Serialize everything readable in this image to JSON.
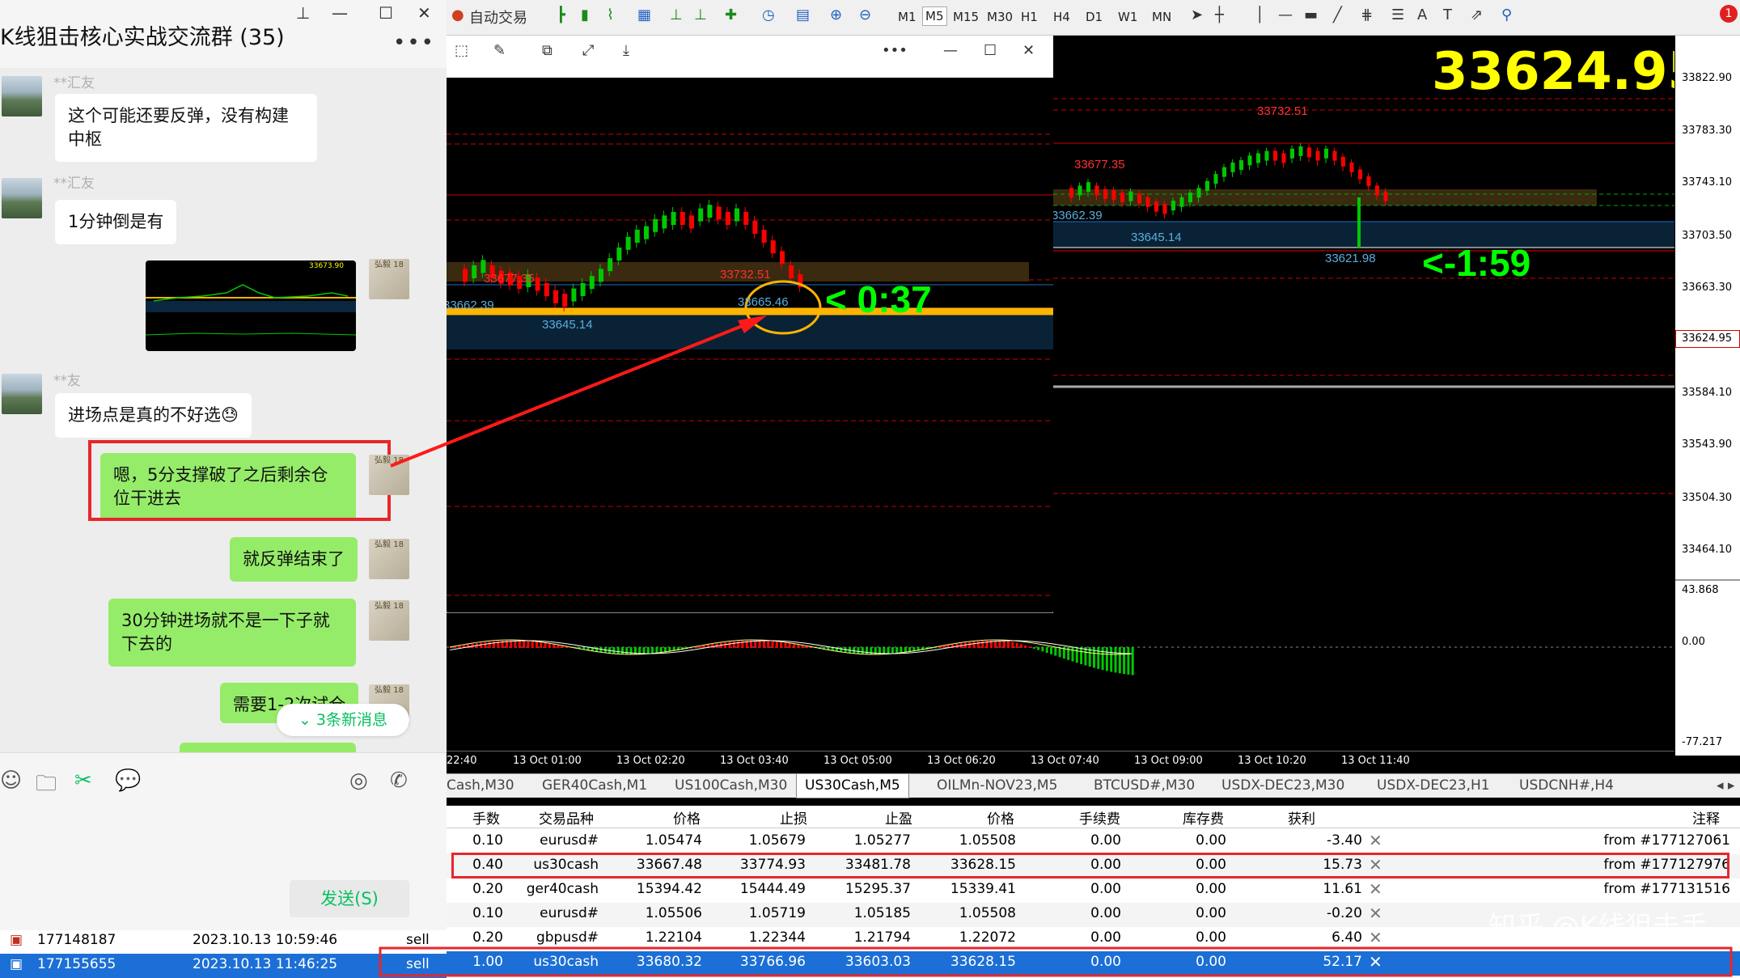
{
  "chat": {
    "title": "K线狙击核心实战交流群 (35)",
    "more": "•••",
    "messages": [
      {
        "sender": "**汇友",
        "text": "这个可能还要反弹，没有构建中枢",
        "side": "left"
      },
      {
        "sender": "**汇友",
        "text": "1分钟倒是有",
        "side": "left"
      },
      {
        "side": "right",
        "image": "33673.90"
      },
      {
        "sender": "**友",
        "text": "进场点是真的不好选😓",
        "side": "left"
      },
      {
        "text": "嗯，5分支撑破了之后剩余仓位干进去",
        "side": "right"
      },
      {
        "text": "就反弹结束了",
        "side": "right"
      },
      {
        "text": "30分钟进场就不是一下子就下去的",
        "side": "right"
      },
      {
        "text": "需要1-2次试仓",
        "side": "right"
      }
    ],
    "new_messages": "⌄ 3条新消息",
    "send_label": "发送(S)",
    "avatar_text": "弘毅\n18"
  },
  "toolbar": {
    "autotrade": "自动交易",
    "timeframes": [
      "M1",
      "M5",
      "M15",
      "M30",
      "H1",
      "H4",
      "D1",
      "W1",
      "MN"
    ],
    "active_tf": "M5",
    "notify_count": "1"
  },
  "chart": {
    "symbol_tabs": [
      "Cash,M30",
      "GER40Cash,M1",
      "US100Cash,M30",
      "US30Cash,M5",
      "OILMn-NOV23,M5",
      "BTCUSD#,M30",
      "USDX-DEC23,M30",
      "USDX-DEC23,H1",
      "USDCNH#,H4"
    ],
    "active_tab": "US30Cash,M5",
    "big_price": "33624.95",
    "current_price_label": "33624.95",
    "price_axis": [
      "33822.90",
      "33783.30",
      "33743.10",
      "33703.50",
      "33663.30",
      "33584.10",
      "33543.90",
      "33504.30",
      "33464.10"
    ],
    "osc_axis": [
      "43.868",
      "0.00",
      "-77.217"
    ],
    "time_axis": [
      "22:40",
      "13 Oct 01:00",
      "13 Oct 02:20",
      "13 Oct 03:40",
      "13 Oct 05:00",
      "13 Oct 06:20",
      "13 Oct 07:40",
      "13 Oct 09:00",
      "13 Oct 10:20",
      "13 Oct 11:40"
    ],
    "left_labels": {
      "high": "33732.51",
      "level1": "33677.35",
      "level2": "33662.39",
      "low": "33645.14",
      "touch": "33665.46",
      "countdown": "< 0:37",
      "big_top": "33673.90"
    },
    "right_labels": {
      "high": "33732.51",
      "level1": "33677.35",
      "level2": "33662.39",
      "low": "33645.14",
      "last": "33621.98",
      "countdown": "<-1:59"
    },
    "colors": {
      "bull": "#00c800",
      "bear": "#ff0000",
      "gold": "#ffb400",
      "countdown": "#00ff00",
      "price": "#ffff00"
    }
  },
  "trade": {
    "headers": [
      "手数",
      "交易品种",
      "价格",
      "止损",
      "止盈",
      "价格",
      "手续费",
      "库存费",
      "获利",
      "注释"
    ],
    "rows": [
      {
        "lots": "0.10",
        "sym": "eurusd#",
        "price": "1.05474",
        "sl": "1.05679",
        "tp": "1.05277",
        "cur": "1.05508",
        "comm": "0.00",
        "swap": "0.00",
        "profit": "-3.40",
        "note": "from #177127061"
      },
      {
        "lots": "0.40",
        "sym": "us30cash",
        "price": "33667.48",
        "sl": "33774.93",
        "tp": "33481.78",
        "cur": "33628.15",
        "comm": "0.00",
        "swap": "0.00",
        "profit": "15.73",
        "note": "from #177127976"
      },
      {
        "lots": "0.20",
        "sym": "ger40cash",
        "price": "15394.42",
        "sl": "15444.49",
        "tp": "15295.37",
        "cur": "15339.41",
        "comm": "0.00",
        "swap": "0.00",
        "profit": "11.61",
        "note": "from #177131516"
      },
      {
        "lots": "0.10",
        "sym": "eurusd#",
        "price": "1.05506",
        "sl": "1.05719",
        "tp": "1.05185",
        "cur": "1.05508",
        "comm": "0.00",
        "swap": "0.00",
        "profit": "-0.20",
        "note": ""
      },
      {
        "lots": "0.20",
        "sym": "gbpusd#",
        "price": "1.22104",
        "sl": "1.22344",
        "tp": "1.21794",
        "cur": "1.22072",
        "comm": "0.00",
        "swap": "0.00",
        "profit": "6.40",
        "note": ""
      },
      {
        "lots": "1.00",
        "sym": "us30cash",
        "price": "33680.32",
        "sl": "33766.96",
        "tp": "33603.03",
        "cur": "33628.15",
        "comm": "0.00",
        "swap": "0.00",
        "profit": "52.17",
        "note": ""
      }
    ],
    "history": [
      {
        "ticket": "177148187",
        "time": "2023.10.13 10:59:46",
        "type": "sell"
      },
      {
        "ticket": "177155655",
        "time": "2023.10.13 11:46:25",
        "type": "sell"
      }
    ]
  },
  "watermark": "知乎 @K线狙击手"
}
